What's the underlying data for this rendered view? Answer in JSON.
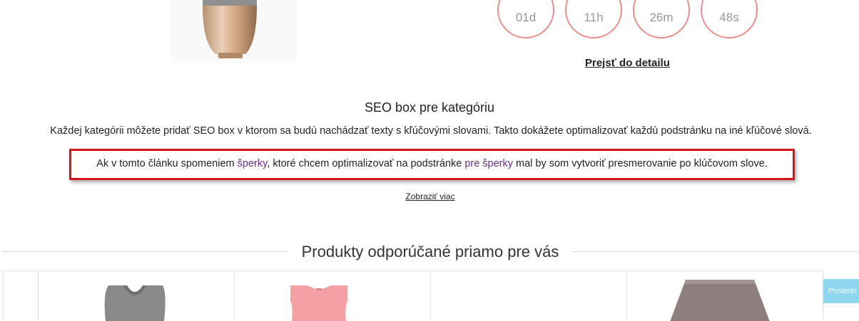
{
  "countdown": {
    "days": "01d",
    "hours": "11h",
    "minutes": "26m",
    "seconds": "48s"
  },
  "detail_link": "Prejsť do detailu",
  "seo": {
    "title": "SEO box pre kategóriu",
    "text": "Každej kategórii môžete pridať SEO box v ktorom sa budú nachádzať texty s kľúčovými slovami. Takto dokážete optimalizovať každú podstránku na iné kľúčové slová.",
    "highlight_part1": "Ak v tomto článku spomeniem ",
    "highlight_link1": "šperky",
    "highlight_part2": ", ktoré chcem optimalizovať na podstránke ",
    "highlight_link2": "pre šperky",
    "highlight_part3": " mal by som vytvoriť presmerovanie po klúčovom slove.",
    "show_more": "Zobraziť viac"
  },
  "recommended": {
    "title": "Produkty odporúčané priamo pre vás"
  },
  "last_viewed_tab": "Posledn",
  "colors": {
    "countdown_border": "#ec8c8c",
    "highlight_border": "#d8141a",
    "keyword_link": "#6a2c8c",
    "last_viewed_bg": "#8fd6f1"
  }
}
